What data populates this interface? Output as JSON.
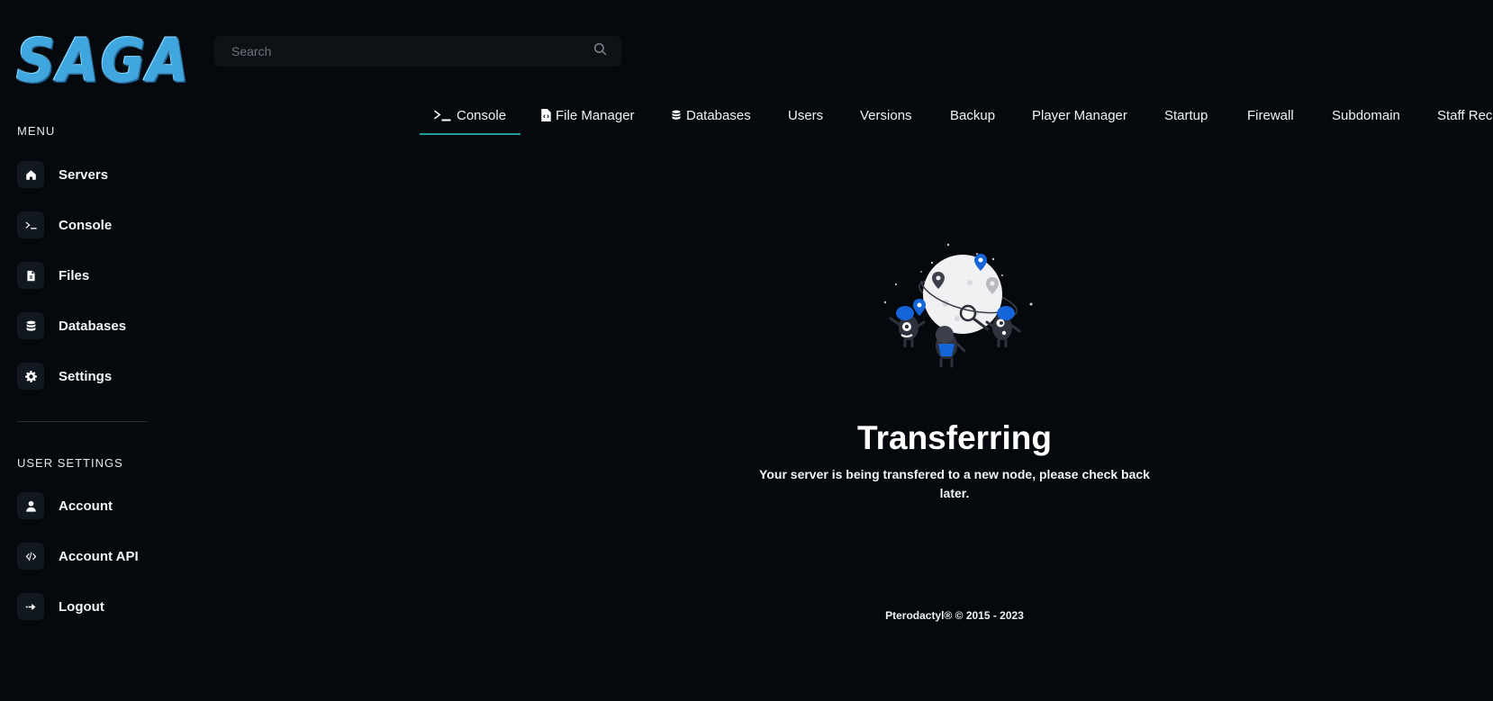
{
  "brand": {
    "logo_text": "SAGA"
  },
  "sidebar": {
    "menu_label": "MENU",
    "menu_items": [
      {
        "label": "Servers",
        "icon": "home-icon"
      },
      {
        "label": "Console",
        "icon": "terminal-icon"
      },
      {
        "label": "Files",
        "icon": "file-icon"
      },
      {
        "label": "Databases",
        "icon": "database-icon"
      },
      {
        "label": "Settings",
        "icon": "gear-icon"
      }
    ],
    "user_label": "USER SETTINGS",
    "user_items": [
      {
        "label": "Account",
        "icon": "user-icon"
      },
      {
        "label": "Account API",
        "icon": "code-icon"
      },
      {
        "label": "Logout",
        "icon": "logout-icon"
      }
    ]
  },
  "search": {
    "placeholder": "Search",
    "icon": "search-icon"
  },
  "tabs": [
    {
      "label": "Console",
      "icon": "terminal-icon",
      "active": true
    },
    {
      "label": "File Manager",
      "icon": "file-code-icon"
    },
    {
      "label": "Databases",
      "icon": "database-icon"
    },
    {
      "label": "Users"
    },
    {
      "label": "Versions"
    },
    {
      "label": "Backup"
    },
    {
      "label": "Player Manager"
    },
    {
      "label": "Startup"
    },
    {
      "label": "Firewall"
    },
    {
      "label": "Subdomain"
    },
    {
      "label": "Staff Rec"
    }
  ],
  "main": {
    "title": "Transferring",
    "message": "Your server is being transfered to a new node, please check back later."
  },
  "footer": {
    "text": "Pterodactyl® © 2015 - 2023"
  },
  "colors": {
    "background": "#05080c",
    "accent": "#1f9c96",
    "icon_bg": "#121820",
    "search_bg": "#0e1217",
    "illustration_blue": "#1565d8"
  }
}
